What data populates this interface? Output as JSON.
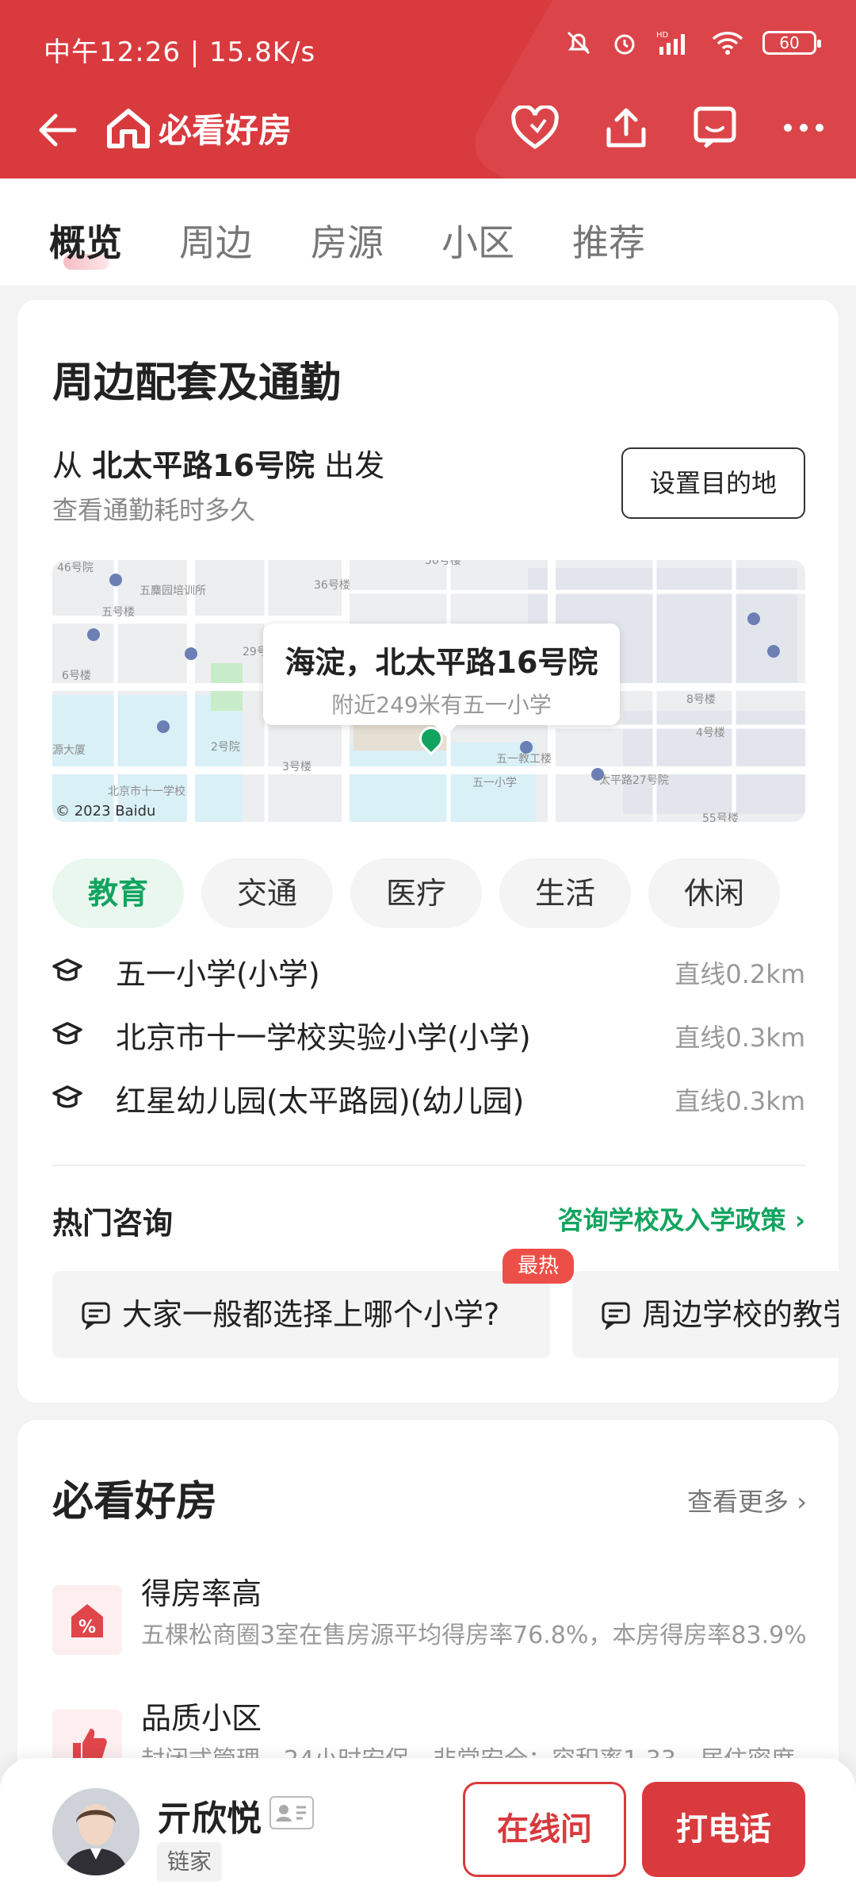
{
  "status_bar": {
    "time_speed": "中午12:26 | 15.8K/s",
    "battery": "60"
  },
  "nav": {
    "app_name": "必看好房"
  },
  "tabs": [
    {
      "label": "概览"
    },
    {
      "label": "周边"
    },
    {
      "label": "房源"
    },
    {
      "label": "小区"
    },
    {
      "label": "推荐"
    }
  ],
  "commute": {
    "title": "周边配套及通勤",
    "from_prefix": "从",
    "from_place": "北太平路16号院",
    "from_suffix": "出发",
    "subtitle": "查看通勤耗时多久",
    "dest_button": "设置目的地"
  },
  "map": {
    "popup_title": "海淀，北太平路16号院",
    "popup_sub": "附近249米有五一小学",
    "copyright": "© 2023 Baidu"
  },
  "chips": [
    {
      "label": "教育"
    },
    {
      "label": "交通"
    },
    {
      "label": "医疗"
    },
    {
      "label": "生活"
    },
    {
      "label": "休闲"
    }
  ],
  "schools": [
    {
      "name": "五一小学(小学)",
      "distance": "直线0.2km"
    },
    {
      "name": "北京市十一学校实验小学(小学)",
      "distance": "直线0.3km"
    },
    {
      "name": "红星幼儿园(太平路园)(幼儿园)",
      "distance": "直线0.3km"
    }
  ],
  "hot": {
    "title": "热门咨询",
    "link": "咨询学校及入学政策",
    "badge": "最热",
    "questions": [
      {
        "text": "大家一般都选择上哪个小学?"
      },
      {
        "text": "周边学校的教学"
      }
    ]
  },
  "must_see": {
    "title": "必看好房",
    "more": "查看更多",
    "features": [
      {
        "title": "得房率高",
        "desc": "五棵松商圈3室在售房源平均得房率76.8%，本房得房率83.9%"
      },
      {
        "title": "品质小区",
        "desc": "封闭式管理，24小时安保，非常安全；容积率1.33，居住密度"
      }
    ]
  },
  "agent": {
    "name": "亓欣悦",
    "company": "链家",
    "online_button": "在线问",
    "call_button": "打电话"
  },
  "colors": {
    "brand": "#d93a3e",
    "green": "#12a45f"
  }
}
